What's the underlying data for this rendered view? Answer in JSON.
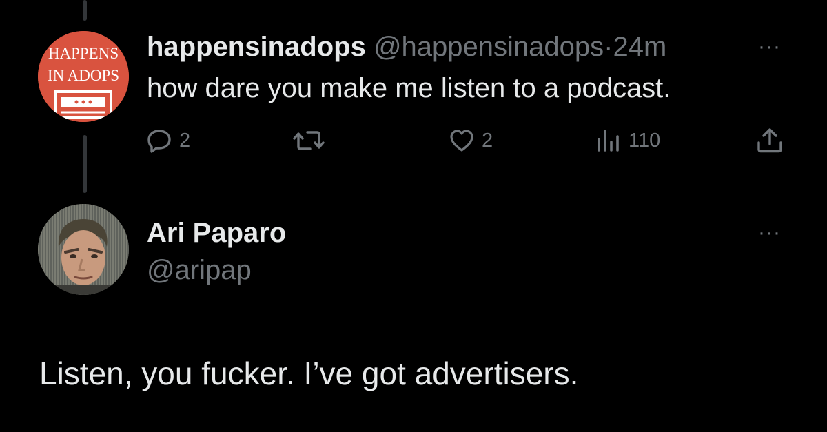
{
  "tweet": {
    "avatar_text_line1": "HAPPENS",
    "avatar_text_line2": "IN ADOPS",
    "display_name": "happensinadops",
    "handle": "@happensinadops",
    "separator": "·",
    "time": "24m",
    "text": "how dare you make me listen to a podcast.",
    "more_label": "···",
    "actions": {
      "reply_count": "2",
      "like_count": "2",
      "views_count": "110"
    },
    "accent_color": "#d9533f"
  },
  "reply": {
    "display_name": "Ari Paparo",
    "handle": "@aripap",
    "more_label": "···",
    "text": "Listen, you fucker. I’ve got advertisers."
  },
  "icons": [
    "reply-icon",
    "retweet-icon",
    "like-icon",
    "views-icon",
    "share-icon",
    "more-icon"
  ],
  "theme": {
    "background": "#000000",
    "text_primary": "#e7e9ea",
    "text_secondary": "#71767b",
    "thread_line": "#333639"
  }
}
